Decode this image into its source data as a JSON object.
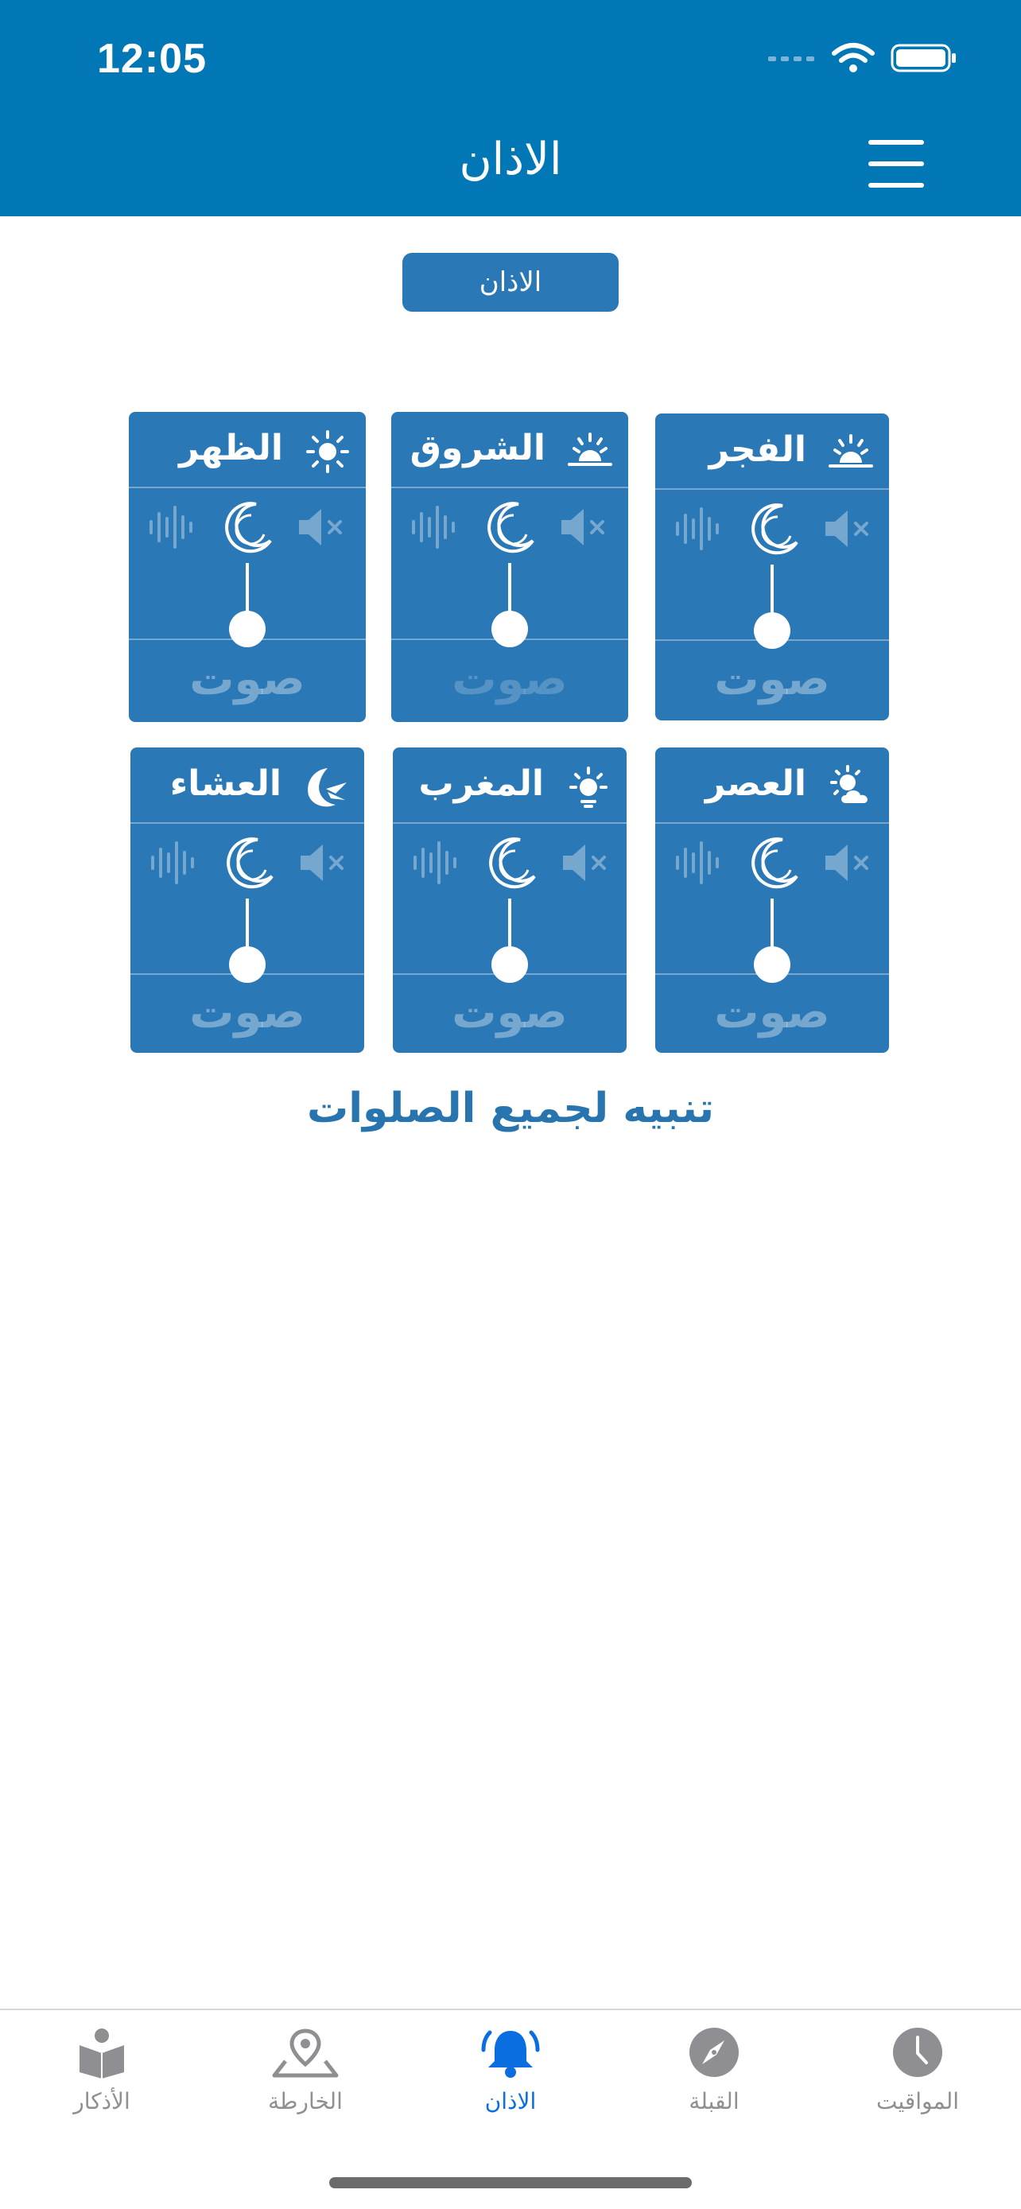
{
  "status_bar": {
    "time": "12:05"
  },
  "header": {
    "title": "الاذان"
  },
  "segment": {
    "label": "الاذان"
  },
  "prayers": [
    {
      "name": "الظهر",
      "icon": "sun-icon",
      "mode": "silent-night",
      "sound_label": "صوت"
    },
    {
      "name": "الشروق",
      "icon": "sunrise-icon",
      "mode": "silent-night",
      "sound_label": "صوت"
    },
    {
      "name": "الفجر",
      "icon": "sunrise-icon",
      "mode": "silent-night",
      "sound_label": "صوت"
    },
    {
      "name": "العشاء",
      "icon": "crescent-night-icon",
      "mode": "silent-night",
      "sound_label": "صوت"
    },
    {
      "name": "المغرب",
      "icon": "sunset-icon",
      "mode": "silent-night",
      "sound_label": "صوت"
    },
    {
      "name": "العصر",
      "icon": "sun-cloud-icon",
      "mode": "silent-night",
      "sound_label": "صوت"
    }
  ],
  "alert_all": "تنبيه لجميع الصلوات",
  "tabbar": {
    "items": [
      {
        "label": "الأذكار",
        "icon": "quran-book-icon"
      },
      {
        "label": "الخارطة",
        "icon": "map-pin-icon"
      },
      {
        "label": "الاذان",
        "icon": "bell-icon",
        "active": true
      },
      {
        "label": "القبلة",
        "icon": "compass-icon"
      },
      {
        "label": "المواقيت",
        "icon": "clock-icon"
      }
    ]
  },
  "colors": {
    "header": "#0277b5",
    "card": "#2b78b6",
    "active_tab": "#0a6de0",
    "text_accent": "#2774ae"
  }
}
